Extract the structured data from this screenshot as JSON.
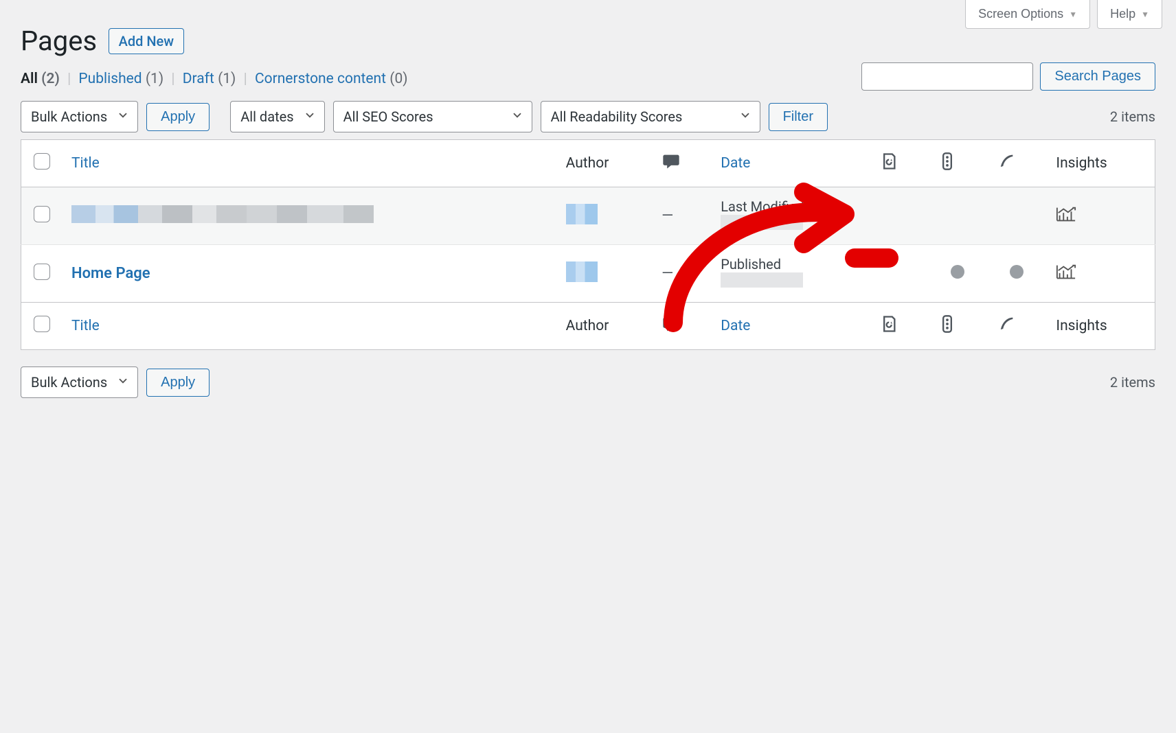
{
  "topButtons": {
    "screenOptions": "Screen Options",
    "help": "Help"
  },
  "page": {
    "title": "Pages",
    "addNew": "Add New"
  },
  "filters": {
    "links": {
      "all": "All",
      "allCount": "(2)",
      "published": "Published",
      "publishedCount": "(1)",
      "draft": "Draft",
      "draftCount": "(1)",
      "cornerstone": "Cornerstone content",
      "cornerstoneCount": "(0)"
    }
  },
  "search": {
    "value": "",
    "buttonLabel": "Search Pages"
  },
  "tablenav": {
    "bulk": "Bulk Actions",
    "apply": "Apply",
    "dates": "All dates",
    "seo": "All SEO Scores",
    "readability": "All Readability Scores",
    "filter": "Filter",
    "itemsCount": "2 items"
  },
  "columns": {
    "title": "Title",
    "author": "Author",
    "date": "Date",
    "insights": "Insights"
  },
  "rows": [
    {
      "title": "",
      "status": "Last Modified",
      "dateText": ""
    },
    {
      "title": "Home Page",
      "status": "Published",
      "dateText": ""
    }
  ]
}
